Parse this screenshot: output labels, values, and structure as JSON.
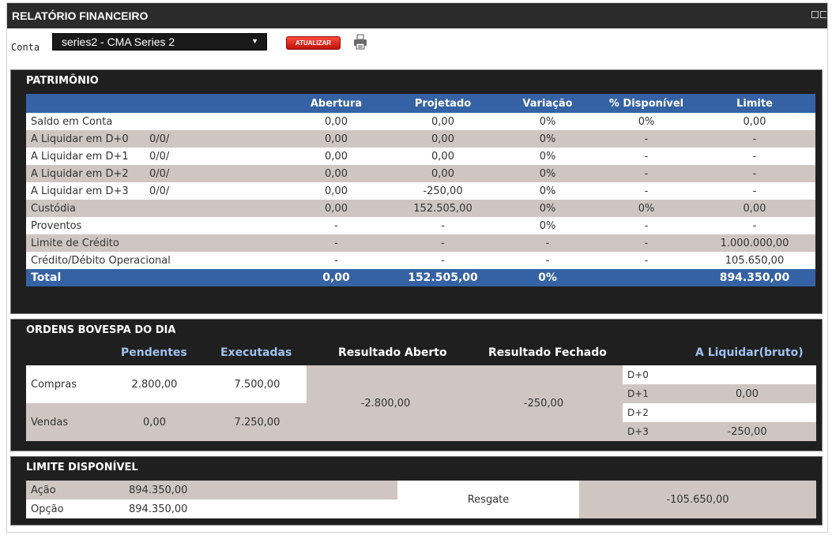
{
  "window": {
    "title": "RELATÓRIO FINANCEIRO"
  },
  "toolbar": {
    "conta_label": "Conta",
    "account_selected": "series2 - CMA Series 2",
    "update_label": "ATUALIZAR",
    "print_icon": "printer-icon"
  },
  "patrimonio": {
    "title": "PATRIMÔNIO",
    "headers": [
      "Abertura",
      "Projetado",
      "Variação",
      "% Disponível",
      "Limite"
    ],
    "rows": [
      {
        "label": "Saldo em Conta",
        "sub": "",
        "abertura": "0,00",
        "projetado": "0,00",
        "variacao": "0%",
        "disponivel": "0%",
        "limite": "0,00"
      },
      {
        "label": "A Liquidar em D+0",
        "sub": "0/0/",
        "abertura": "0,00",
        "projetado": "0,00",
        "variacao": "0%",
        "disponivel": "-",
        "limite": "-"
      },
      {
        "label": "A Liquidar em D+1",
        "sub": "0/0/",
        "abertura": "0,00",
        "projetado": "0,00",
        "variacao": "0%",
        "disponivel": "-",
        "limite": "-"
      },
      {
        "label": "A Liquidar em D+2",
        "sub": "0/0/",
        "abertura": "0,00",
        "projetado": "0,00",
        "variacao": "0%",
        "disponivel": "-",
        "limite": "-"
      },
      {
        "label": "A Liquidar em D+3",
        "sub": "0/0/",
        "abertura": "0,00",
        "projetado": "-250,00",
        "variacao": "0%",
        "disponivel": "-",
        "limite": "-"
      },
      {
        "label": "Custódia",
        "sub": "",
        "abertura": "0,00",
        "projetado": "152.505,00",
        "variacao": "0%",
        "disponivel": "0%",
        "limite": "0,00"
      },
      {
        "label": "Proventos",
        "sub": "",
        "abertura": "-",
        "projetado": "-",
        "variacao": "0%",
        "disponivel": "-",
        "limite": "-"
      },
      {
        "label": "Limite de Crédito",
        "sub": "",
        "abertura": "-",
        "projetado": "-",
        "variacao": "-",
        "disponivel": "-",
        "limite": "1.000.000,00"
      },
      {
        "label": "Crédito/Débito Operacional",
        "sub": "",
        "abertura": "-",
        "projetado": "-",
        "variacao": "-",
        "disponivel": "-",
        "limite": "105.650,00"
      }
    ],
    "total": {
      "label": "Total",
      "abertura": "0,00",
      "projetado": "152.505,00",
      "variacao": "0%",
      "disponivel": "",
      "limite": "894.350,00"
    }
  },
  "ordens": {
    "title": "ORDENS BOVESPA DO DIA",
    "headers": [
      "Pendentes",
      "Executadas",
      "Resultado Aberto",
      "Resultado Fechado",
      "A Liquidar(bruto)"
    ],
    "compras": {
      "label": "Compras",
      "pendentes": "2.800,00",
      "executadas": "7.500,00"
    },
    "vendas": {
      "label": "Vendas",
      "pendentes": "0,00",
      "executadas": "7.250,00"
    },
    "resultado_aberto": "-2.800,00",
    "resultado_fechado": "-250,00",
    "liquidar": [
      {
        "label": "D+0",
        "value": ""
      },
      {
        "label": "D+1",
        "value": "0,00"
      },
      {
        "label": "D+2",
        "value": ""
      },
      {
        "label": "D+3",
        "value": "-250,00"
      }
    ]
  },
  "limite": {
    "title": "LIMITE DISPONÍVEL",
    "acao": {
      "label": "Ação",
      "value": "894.350,00"
    },
    "opcao": {
      "label": "Opção",
      "value": "894.350,00"
    },
    "resgate_label": "Resgate",
    "resgate_value": "-105.650,00"
  }
}
